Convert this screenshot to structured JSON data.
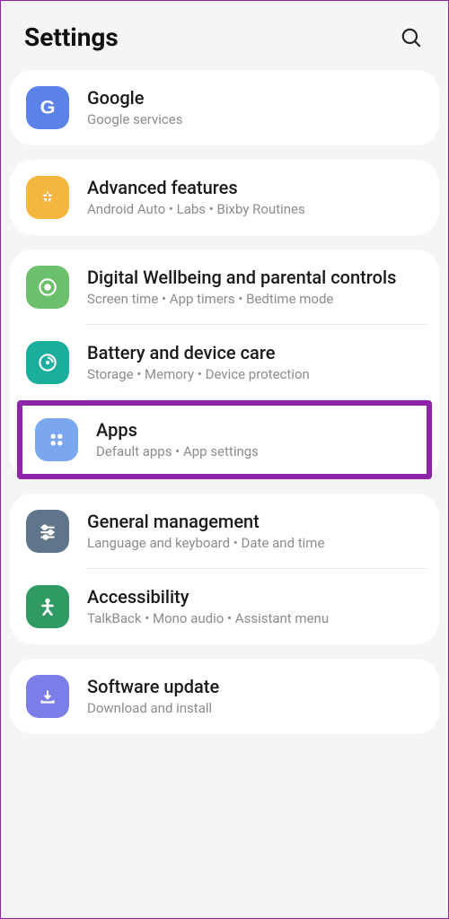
{
  "header": {
    "title": "Settings"
  },
  "groups": [
    {
      "items": [
        {
          "id": "google",
          "icon": "google",
          "color": "#5b82e8",
          "label": "Google",
          "sub": "Google services"
        }
      ]
    },
    {
      "items": [
        {
          "id": "advanced",
          "icon": "plus",
          "color": "#f4b63e",
          "label": "Advanced features",
          "sub": "Android Auto  •  Labs  •  Bixby Routines"
        }
      ]
    },
    {
      "items": [
        {
          "id": "wellbeing",
          "icon": "heart",
          "color": "#6cc06c",
          "label": "Digital Wellbeing and parental controls",
          "sub": "Screen time  •  App timers  •  Bedtime mode"
        },
        {
          "id": "battery",
          "icon": "care",
          "color": "#1aaf9c",
          "label": "Battery and device care",
          "sub": "Storage  •  Memory  •  Device protection"
        },
        {
          "id": "apps",
          "icon": "apps",
          "color": "#7aa7ed",
          "label": "Apps",
          "sub": "Default apps  •  App settings",
          "highlighted": true
        }
      ]
    },
    {
      "items": [
        {
          "id": "general",
          "icon": "sliders",
          "color": "#5f7589",
          "label": "General management",
          "sub": "Language and keyboard  •  Date and time"
        },
        {
          "id": "accessibility",
          "icon": "person",
          "color": "#2f9b63",
          "label": "Accessibility",
          "sub": "TalkBack  •  Mono audio  •  Assistant menu"
        }
      ]
    },
    {
      "items": [
        {
          "id": "update",
          "icon": "update",
          "color": "#7b7de8",
          "label": "Software update",
          "sub": "Download and install"
        }
      ]
    }
  ]
}
